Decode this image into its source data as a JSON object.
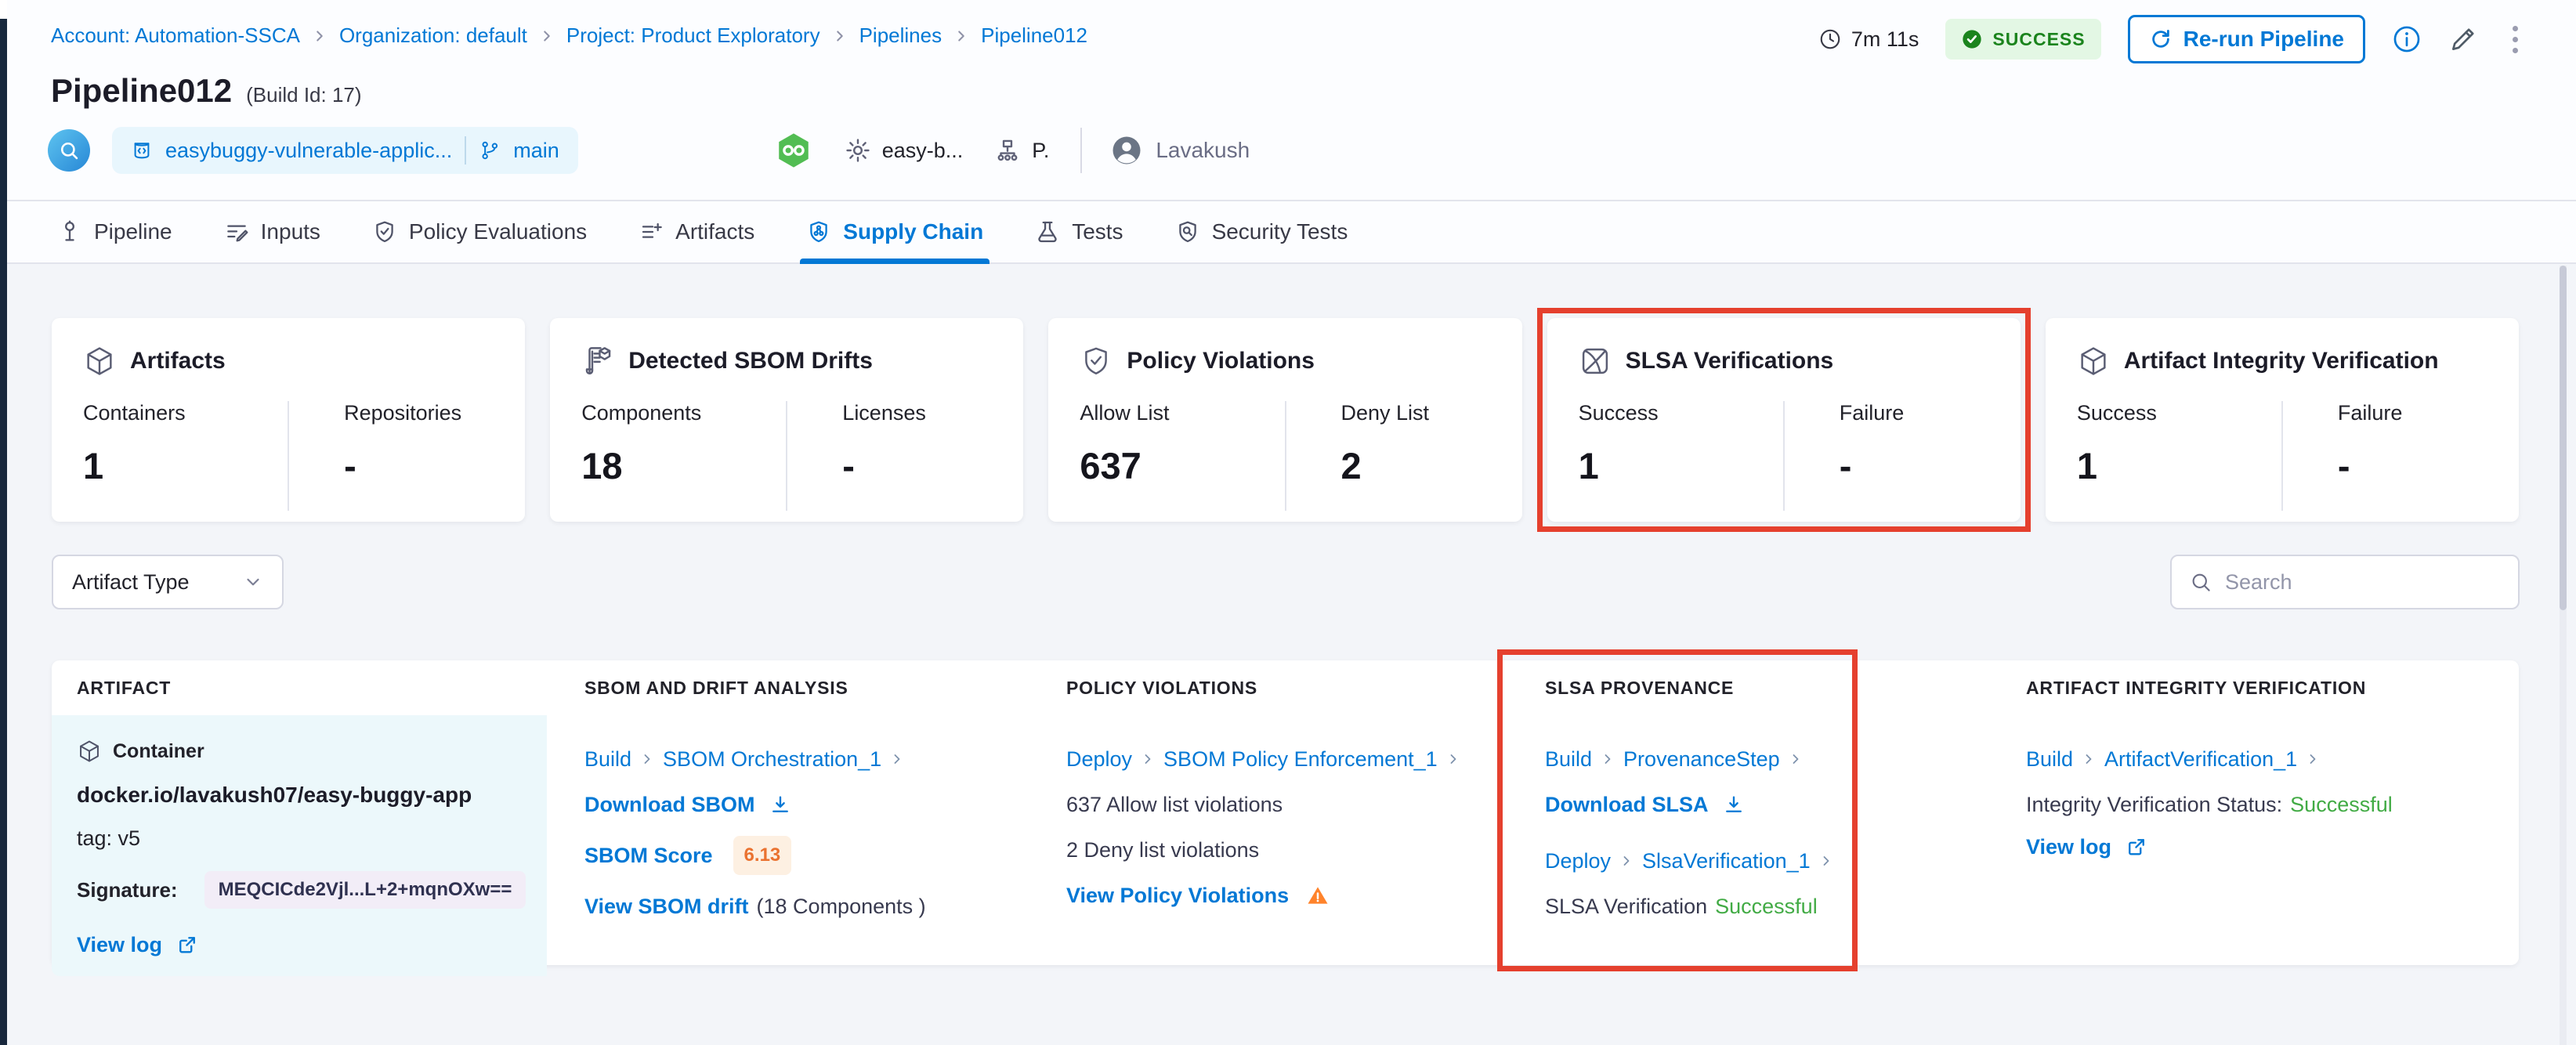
{
  "breadcrumb": {
    "items": [
      "Account: Automation-SSCA",
      "Organization: default",
      "Project: Product Exploratory",
      "Pipelines",
      "Pipeline012"
    ]
  },
  "topbar": {
    "duration": "7m 11s",
    "status_label": "SUCCESS",
    "rerun_label": "Re-run Pipeline"
  },
  "header": {
    "title": "Pipeline012",
    "build_id": "(Build Id: 17)",
    "repo_name": "easybuggy-vulnerable-applic...",
    "branch": "main",
    "trigger_config": "easy-b...",
    "trigger_env": "P.",
    "user_name": "Lavakush"
  },
  "tabs": [
    {
      "label": "Pipeline"
    },
    {
      "label": "Inputs"
    },
    {
      "label": "Policy Evaluations"
    },
    {
      "label": "Artifacts"
    },
    {
      "label": "Supply Chain",
      "active": true
    },
    {
      "label": "Tests"
    },
    {
      "label": "Security Tests"
    }
  ],
  "summary_cards": [
    {
      "title": "Artifacts",
      "stat1_label": "Containers",
      "stat1_value": "1",
      "stat2_label": "Repositories",
      "stat2_value": "-"
    },
    {
      "title": "Detected SBOM Drifts",
      "stat1_label": "Components",
      "stat1_value": "18",
      "stat2_label": "Licenses",
      "stat2_value": "-"
    },
    {
      "title": "Policy Violations",
      "stat1_label": "Allow List",
      "stat1_value": "637",
      "stat2_label": "Deny List",
      "stat2_value": "2"
    },
    {
      "title": "SLSA Verifications",
      "stat1_label": "Success",
      "stat1_value": "1",
      "stat2_label": "Failure",
      "stat2_value": "-",
      "highlighted": true
    },
    {
      "title": "Artifact Integrity Verification",
      "stat1_label": "Success",
      "stat1_value": "1",
      "stat2_label": "Failure",
      "stat2_value": "-"
    }
  ],
  "filters": {
    "artifact_type_label": "Artifact Type",
    "search_placeholder": "Search"
  },
  "table": {
    "headers": [
      "ARTIFACT",
      "SBOM AND DRIFT ANALYSIS",
      "POLICY VIOLATIONS",
      "SLSA PROVENANCE",
      "ARTIFACT INTEGRITY VERIFICATION"
    ],
    "row": {
      "artifact": {
        "type": "Container",
        "name": "docker.io/lavakush07/easy-buggy-app",
        "tag": "tag: v5",
        "signature_label": "Signature:",
        "signature_value": "MEQCICde2Vjl...L+2+mqnOXw==",
        "view_log": "View log"
      },
      "sbom": {
        "stage": "Build",
        "step": "SBOM Orchestration_1",
        "download": "Download SBOM",
        "score_label": "SBOM Score",
        "score": "6.13",
        "drift_link": "View SBOM drift",
        "drift_note": "(18 Components )"
      },
      "policy": {
        "stage": "Deploy",
        "step": "SBOM Policy Enforcement_1",
        "allow": "637 Allow list violations",
        "deny": "2 Deny list violations",
        "view": "View Policy Violations"
      },
      "slsa": {
        "stage1": "Build",
        "step1": "ProvenanceStep",
        "download": "Download SLSA",
        "stage2": "Deploy",
        "step2": "SlsaVerification_1",
        "status_label": "SLSA Verification",
        "status_value": "Successful"
      },
      "integrity": {
        "stage": "Build",
        "step": "ArtifactVerification_1",
        "status_label": "Integrity Verification Status:",
        "status_value": "Successful",
        "view_log": "View log"
      }
    }
  },
  "colors": {
    "accent_blue": "#0278d5",
    "success_green": "#42ab45",
    "badge_green_bg": "#e3f7e4",
    "badge_green_text": "#1b841d",
    "highlight_red": "#e5402e",
    "warning_orange": "#ff832b",
    "score_orange": "#ea7230",
    "artifact_cell_bg": "#ecf8fb",
    "nav_edge": "#18283d"
  }
}
